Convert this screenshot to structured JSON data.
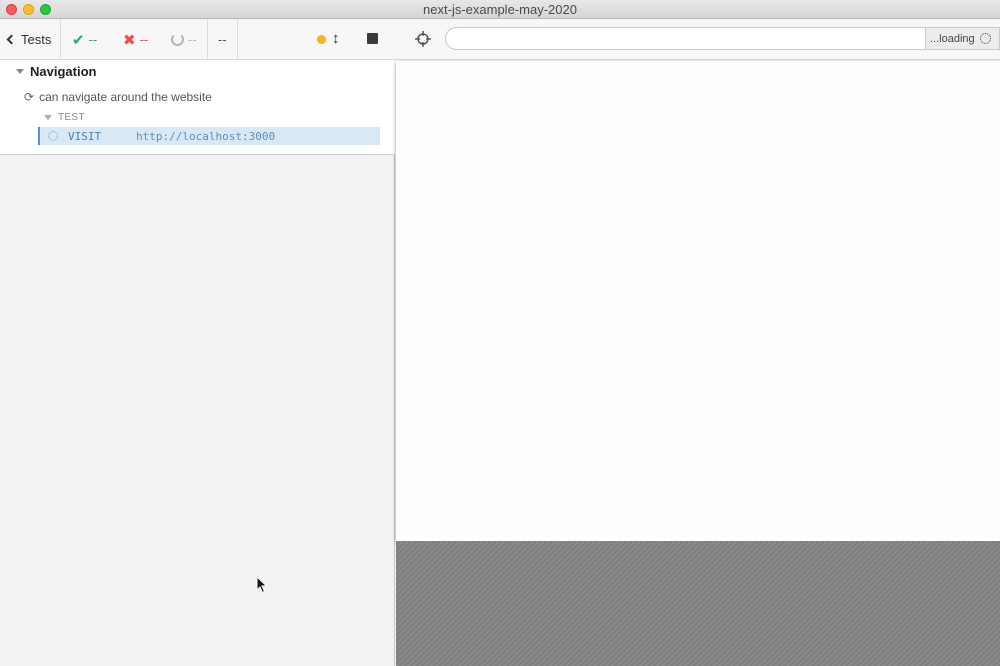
{
  "window": {
    "title": "next-js-example-may-2020"
  },
  "stats": {
    "tests_label": "Tests",
    "passed": "--",
    "failed": "--",
    "pending": "--",
    "duration": "--",
    "colors": {
      "passed": "#2aa573",
      "failed": "#e94f4f",
      "pending": "#b5b5b5",
      "running": "#f5b322"
    }
  },
  "reporter": {
    "suite": "Navigation",
    "test": "can navigate around the website",
    "hook": "TEST",
    "command": {
      "name": "VISIT",
      "message": "http://localhost:3000"
    }
  },
  "aut": {
    "url": "",
    "loading_label": "...loading"
  },
  "icons": [
    "chevron-left-icon",
    "check-icon",
    "x-icon",
    "pending-ring-icon",
    "running-dot-icon",
    "autoscroll-icon",
    "stop-icon",
    "refresh-icon",
    "spinner-icon",
    "crosshair-icon",
    "cursor-icon"
  ]
}
